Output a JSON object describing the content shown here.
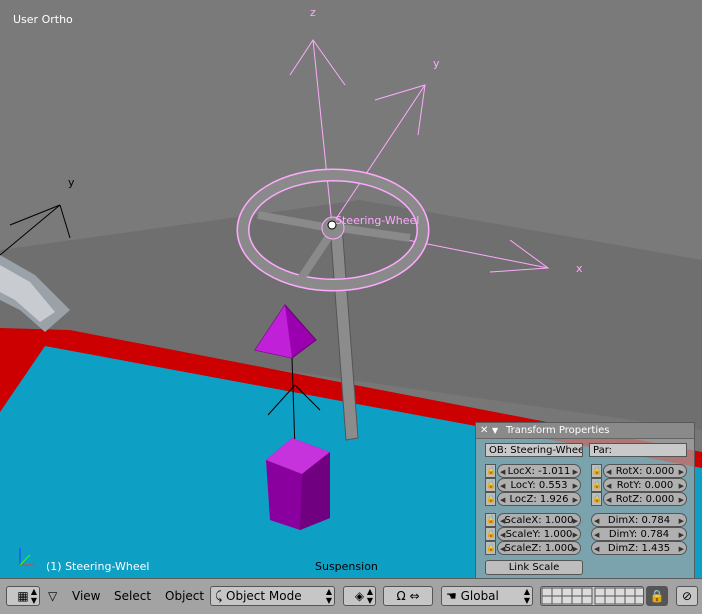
{
  "viewport": {
    "view_name": "User Ortho",
    "object_info": "(1) Steering-Wheel",
    "footer_label": "Suspension",
    "object_label": "Steering-Wheel",
    "axis_labels": {
      "z": "z",
      "y": "y",
      "x": "x",
      "y2": "y"
    },
    "colors": {
      "floor_blue": "#0d9fc4",
      "floor_red": "#cc0000",
      "selection": "#ffaaff",
      "object_purple": "#9a00b0"
    }
  },
  "transform_panel": {
    "title": "Transform Properties",
    "ob_field": "OB: Steering-Wheel",
    "par_field": "Par:",
    "loc": [
      "LocX: -1.011",
      "LocY: 0.553",
      "LocZ: 1.926"
    ],
    "rot": [
      "RotX: 0.000",
      "RotY: 0.000",
      "RotZ: 0.000"
    ],
    "scale": [
      "ScaleX: 1.000",
      "ScaleY: 1.000",
      "ScaleZ: 1.000"
    ],
    "dim": [
      "DimX: 0.784",
      "DimY: 0.784",
      "DimZ: 1.435"
    ],
    "link_scale": "Link Scale"
  },
  "header": {
    "menus": [
      "View",
      "Select",
      "Object"
    ],
    "mode": "Object Mode",
    "orientation": "Global"
  }
}
